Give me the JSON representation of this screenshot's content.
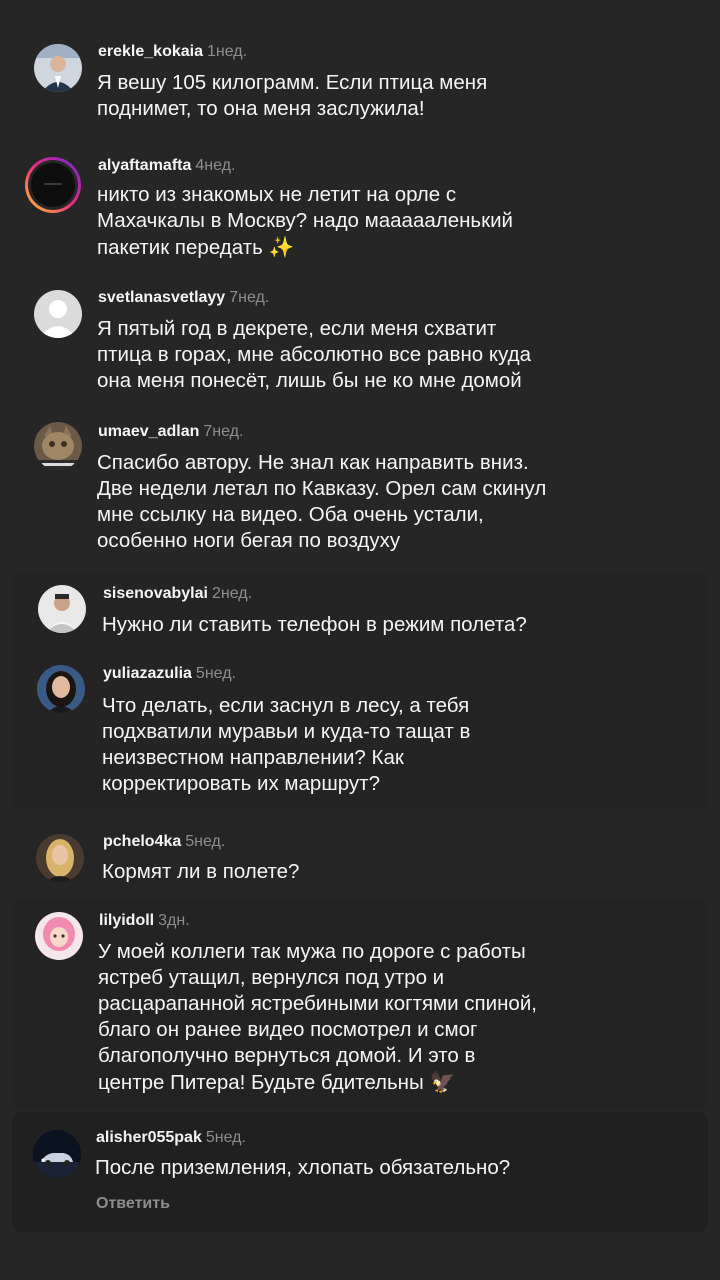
{
  "comments": [
    {
      "username": "erekle_kokaia",
      "time": "1нед.",
      "text": "Я вешу 105 килограмм. Если птица меня\nподнимет, то она меня заслужила!",
      "avatar": "avatar-man-suit"
    },
    {
      "username": "alyaftamafta",
      "time": "4нед.",
      "text": "никто из знакомых не летит на орле с\nМахачкалы в Москву? надо маааааленький\nпакетик передать",
      "emoji": "✨",
      "avatar": "avatar-dark-story-ring"
    },
    {
      "username": "svetlanasvetlayy",
      "time": "7нед.",
      "text": "Я пятый год в декрете, если меня схватит\nптица в горах, мне абсолютно все равно куда\nона меня понесёт, лишь бы не ко мне домой",
      "avatar": "avatar-default-user"
    },
    {
      "username": "umaev_adlan",
      "time": "7нед.",
      "text": "Спасибо автору. Не знал как направить вниз.\nДве недели летал по Кавказу. Орел сам скинул\nмне ссылку на видео. Оба очень устали,\nособенно ноги бегая по воздуху",
      "avatar": "avatar-cat"
    },
    {
      "username": "sisenovabylai",
      "time": "2нед.",
      "text": "Нужно ли ставить телефон в режим полета?",
      "avatar": "avatar-man-white"
    },
    {
      "username": "yuliazazulia",
      "time": "5нед.",
      "text": "Что делать, если заснул в лесу, а тебя\nподхватили муравьи и куда-то тащат в\nнеизвестном направлении? Как\nкорректировать их маршрут?",
      "avatar": "avatar-woman-dark-hair"
    },
    {
      "username": "pchelo4ka",
      "time": "5нед.",
      "text": "Кормят ли в полете?",
      "avatar": "avatar-woman-blonde"
    },
    {
      "username": "lilyidoll",
      "time": "3дн.",
      "text": "У моей коллеги так мужа по дороге с работы\nястреб утащил, вернулся под утро и\nрасцарапанной ястребиными когтями спиной,\nблаго он ранее видео посмотрел и смог\nблагополучно вернуться домой. И это в\nцентре Питера! Будьте бдительны",
      "emoji": "🦅",
      "avatar": "avatar-pink-hair"
    },
    {
      "username": "alisher055pak",
      "time": "5нед.",
      "text": "После приземления, хлопать обязательно?",
      "reply": "Ответить",
      "avatar": "avatar-car-night"
    }
  ]
}
